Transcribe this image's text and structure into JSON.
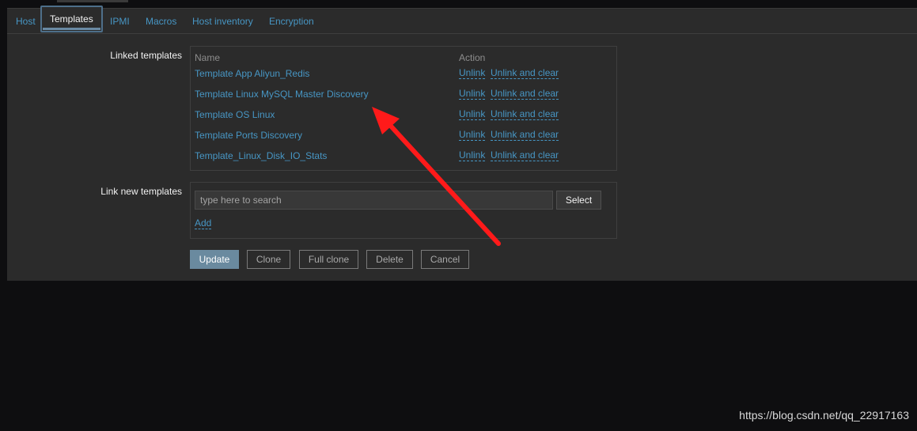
{
  "tabs": [
    {
      "label": "Host",
      "active": false
    },
    {
      "label": "Templates",
      "active": true
    },
    {
      "label": "IPMI",
      "active": false
    },
    {
      "label": "Macros",
      "active": false
    },
    {
      "label": "Host inventory",
      "active": false
    },
    {
      "label": "Encryption",
      "active": false
    }
  ],
  "linked_templates": {
    "label": "Linked templates",
    "col_name": "Name",
    "col_action": "Action",
    "unlink_label": "Unlink",
    "unlink_clear_label": "Unlink and clear",
    "rows": [
      "Template App Aliyun_Redis",
      "Template Linux MySQL Master Discovery",
      "Template OS Linux",
      "Template Ports Discovery",
      "Template_Linux_Disk_IO_Stats"
    ]
  },
  "link_new": {
    "label": "Link new templates",
    "search_placeholder": "type here to search",
    "select_label": "Select",
    "add_label": "Add"
  },
  "buttons": {
    "update": "Update",
    "clone": "Clone",
    "full_clone": "Full clone",
    "delete": "Delete",
    "cancel": "Cancel"
  },
  "watermark": "https://blog.csdn.net/qq_22917163",
  "colors": {
    "link": "#4796c4",
    "panel": "#2b2b2b",
    "page": "#0e0e10",
    "primary_button": "#6a8a9f",
    "annotation_arrow": "#ff1a1a"
  }
}
